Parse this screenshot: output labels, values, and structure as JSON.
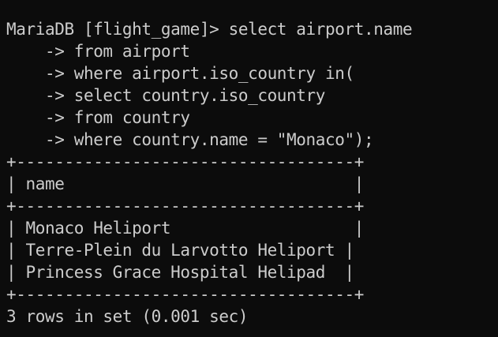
{
  "terminal": {
    "lines": [
      "MariaDB [flight_game]> select airport.name",
      "    -> from airport",
      "    -> where airport.iso_country in(",
      "    -> select country.iso_country",
      "    -> from country",
      "    -> where country.name = \"Monaco\");",
      "+-----------------------------------+",
      "| name                              |",
      "+-----------------------------------+",
      "| Monaco Heliport                   |",
      "| Terre-Plein du Larvotto Heliport |",
      "| Princess Grace Hospital Helipad  |",
      "+-----------------------------------+",
      "3 rows in set (0.001 sec)"
    ]
  },
  "colors": {
    "background": "#0c0c0c",
    "foreground": "#cccccc"
  }
}
